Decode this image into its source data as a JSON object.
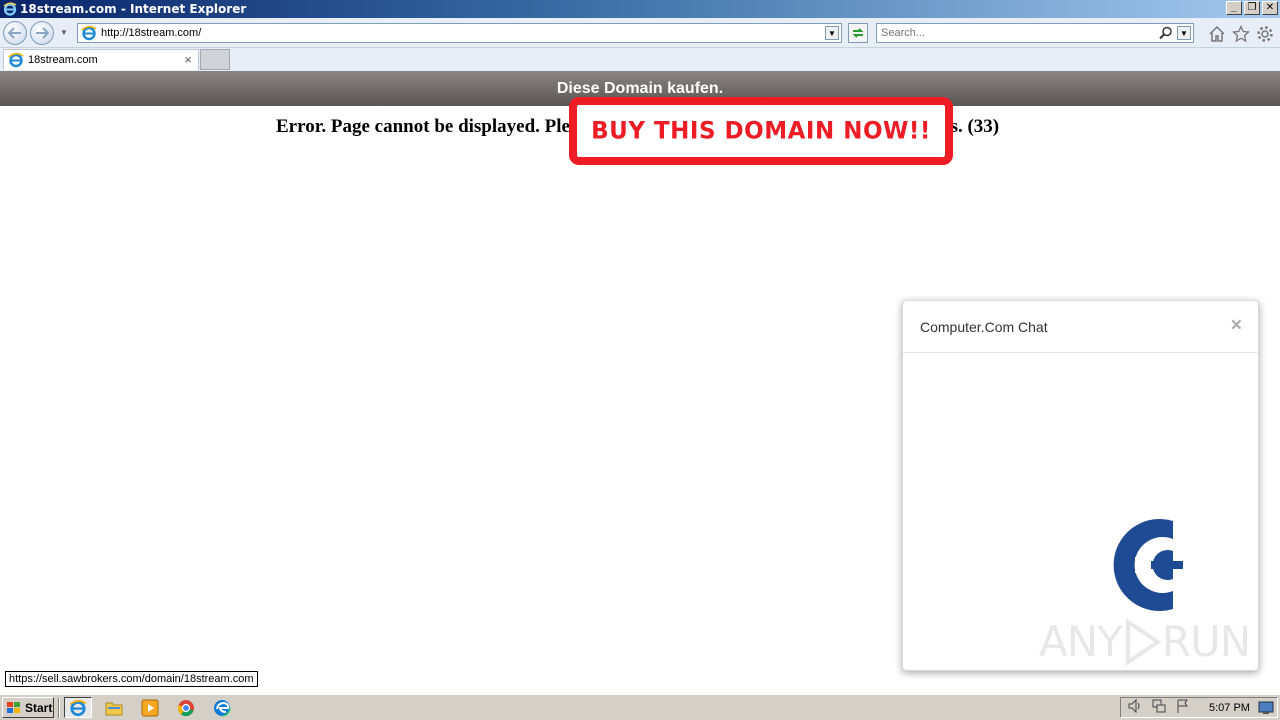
{
  "window": {
    "title": "18stream.com - Internet Explorer",
    "minimize": "_",
    "restore": "❐",
    "close": "✕"
  },
  "navbar": {
    "url": "http://18stream.com/",
    "search_placeholder": "Search..."
  },
  "tabs": [
    {
      "label": "18stream.com",
      "close": "×"
    }
  ],
  "page": {
    "domain_bar": "Diese Domain kaufen.",
    "error_visible_start": "Error. Page cannot be displayed. Ple",
    "error_visible_end": "ds. (33)",
    "overlay_banner": "BUY THIS DOMAIN NOW!!"
  },
  "chat": {
    "title": "Computer.Com Chat",
    "close": "×"
  },
  "watermark": {
    "left": "ANY",
    "right": "RUN"
  },
  "status_bar": {
    "link_url": "https://sell.sawbrokers.com/domain/18stream.com"
  },
  "taskbar": {
    "start_label": "Start",
    "clock": "5:07 PM"
  },
  "colors": {
    "banner_red": "#ee1c24",
    "chat_logo_blue": "#1f4a94",
    "domain_bar_gray": "#6e6a69"
  }
}
